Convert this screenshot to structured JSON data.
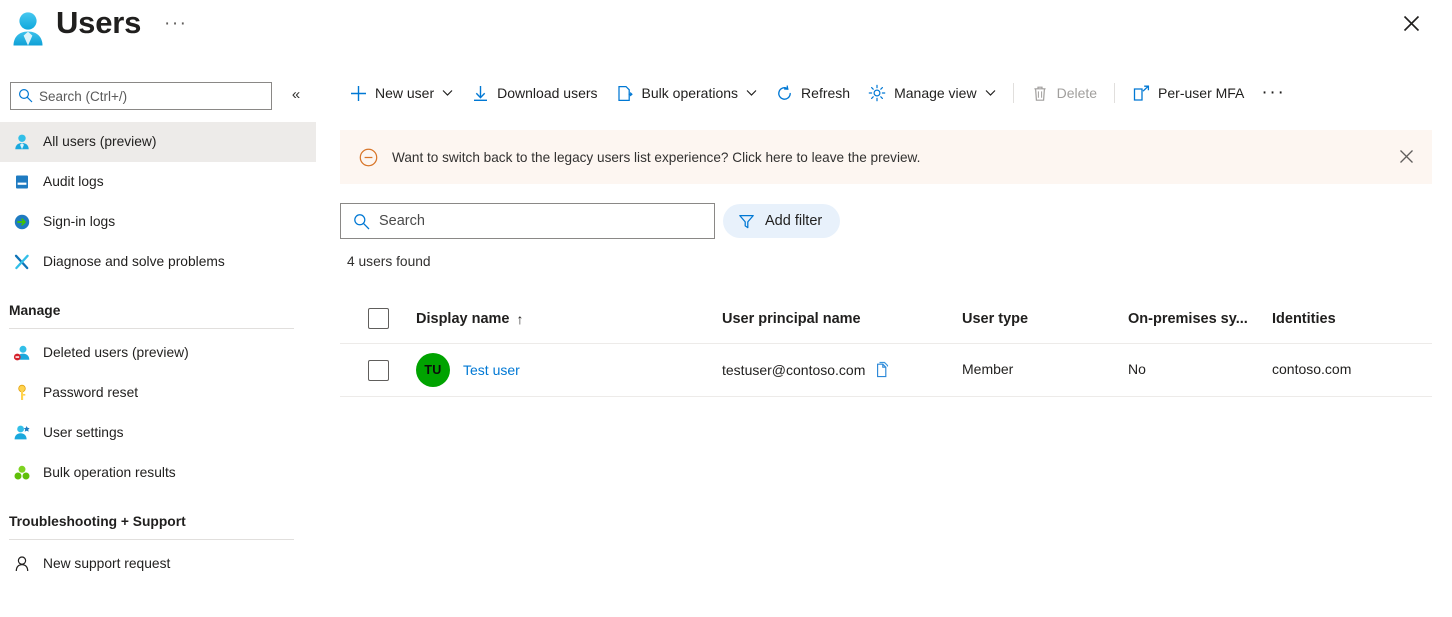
{
  "header": {
    "title": "Users",
    "ellipsis_label": "···",
    "close_label": "✕",
    "icon": "users-blade-icon"
  },
  "sidebar": {
    "search": {
      "placeholder": "Search (Ctrl+/)",
      "value": ""
    },
    "collapse_label": "«",
    "items": [
      {
        "label": "All users (preview)",
        "icon": "user-icon",
        "selected": true
      },
      {
        "label": "Audit logs",
        "icon": "audit-log-icon",
        "selected": false
      },
      {
        "label": "Sign-in logs",
        "icon": "sign-in-icon",
        "selected": false
      },
      {
        "label": "Diagnose and solve problems",
        "icon": "wrench-screwdriver-icon",
        "selected": false
      }
    ],
    "groups": [
      {
        "title": "Manage",
        "items": [
          {
            "label": "Deleted users (preview)",
            "icon": "deleted-user-icon"
          },
          {
            "label": "Password reset",
            "icon": "key-icon"
          },
          {
            "label": "User settings",
            "icon": "user-settings-icon"
          },
          {
            "label": "Bulk operation results",
            "icon": "bulk-operations-icon"
          }
        ]
      },
      {
        "title": "Troubleshooting + Support",
        "items": [
          {
            "label": "New support request",
            "icon": "support-person-icon"
          }
        ]
      }
    ]
  },
  "toolbar": {
    "new_user": "New user",
    "download_users": "Download users",
    "bulk_operations": "Bulk operations",
    "refresh": "Refresh",
    "manage_view": "Manage view",
    "delete": "Delete",
    "per_user_mfa": "Per-user MFA",
    "more": "···"
  },
  "banner": {
    "text": "Want to switch back to the legacy users list experience? Click here to leave the preview.",
    "close_label": "✕",
    "background": "#fdf6f1",
    "icon_color": "#d8762a",
    "icon": "minus-circle-icon"
  },
  "filters": {
    "search": {
      "placeholder": "Search",
      "value": ""
    },
    "add_filter": "Add filter",
    "add_filter_bg": "#e8f1fb"
  },
  "results": {
    "count_text": "4 users found"
  },
  "table": {
    "columns": [
      "Display name",
      "User principal name",
      "User type",
      "On-premises sy...",
      "Identities"
    ],
    "sort": {
      "column": "Display name",
      "direction": "↑"
    },
    "rows": [
      {
        "selected": false,
        "initials": "TU",
        "avatar_color": "#00a300",
        "display_name": "Test user",
        "user_principal_name": "testuser@contoso.com",
        "copy_icon": "copy-icon",
        "user_type": "Member",
        "on_premises_sync": "No",
        "identities": "contoso.com"
      }
    ]
  },
  "colors": {
    "accent": "#0078d4",
    "selected_row_bg": "#edebe9",
    "border": "#e1dfdd"
  }
}
